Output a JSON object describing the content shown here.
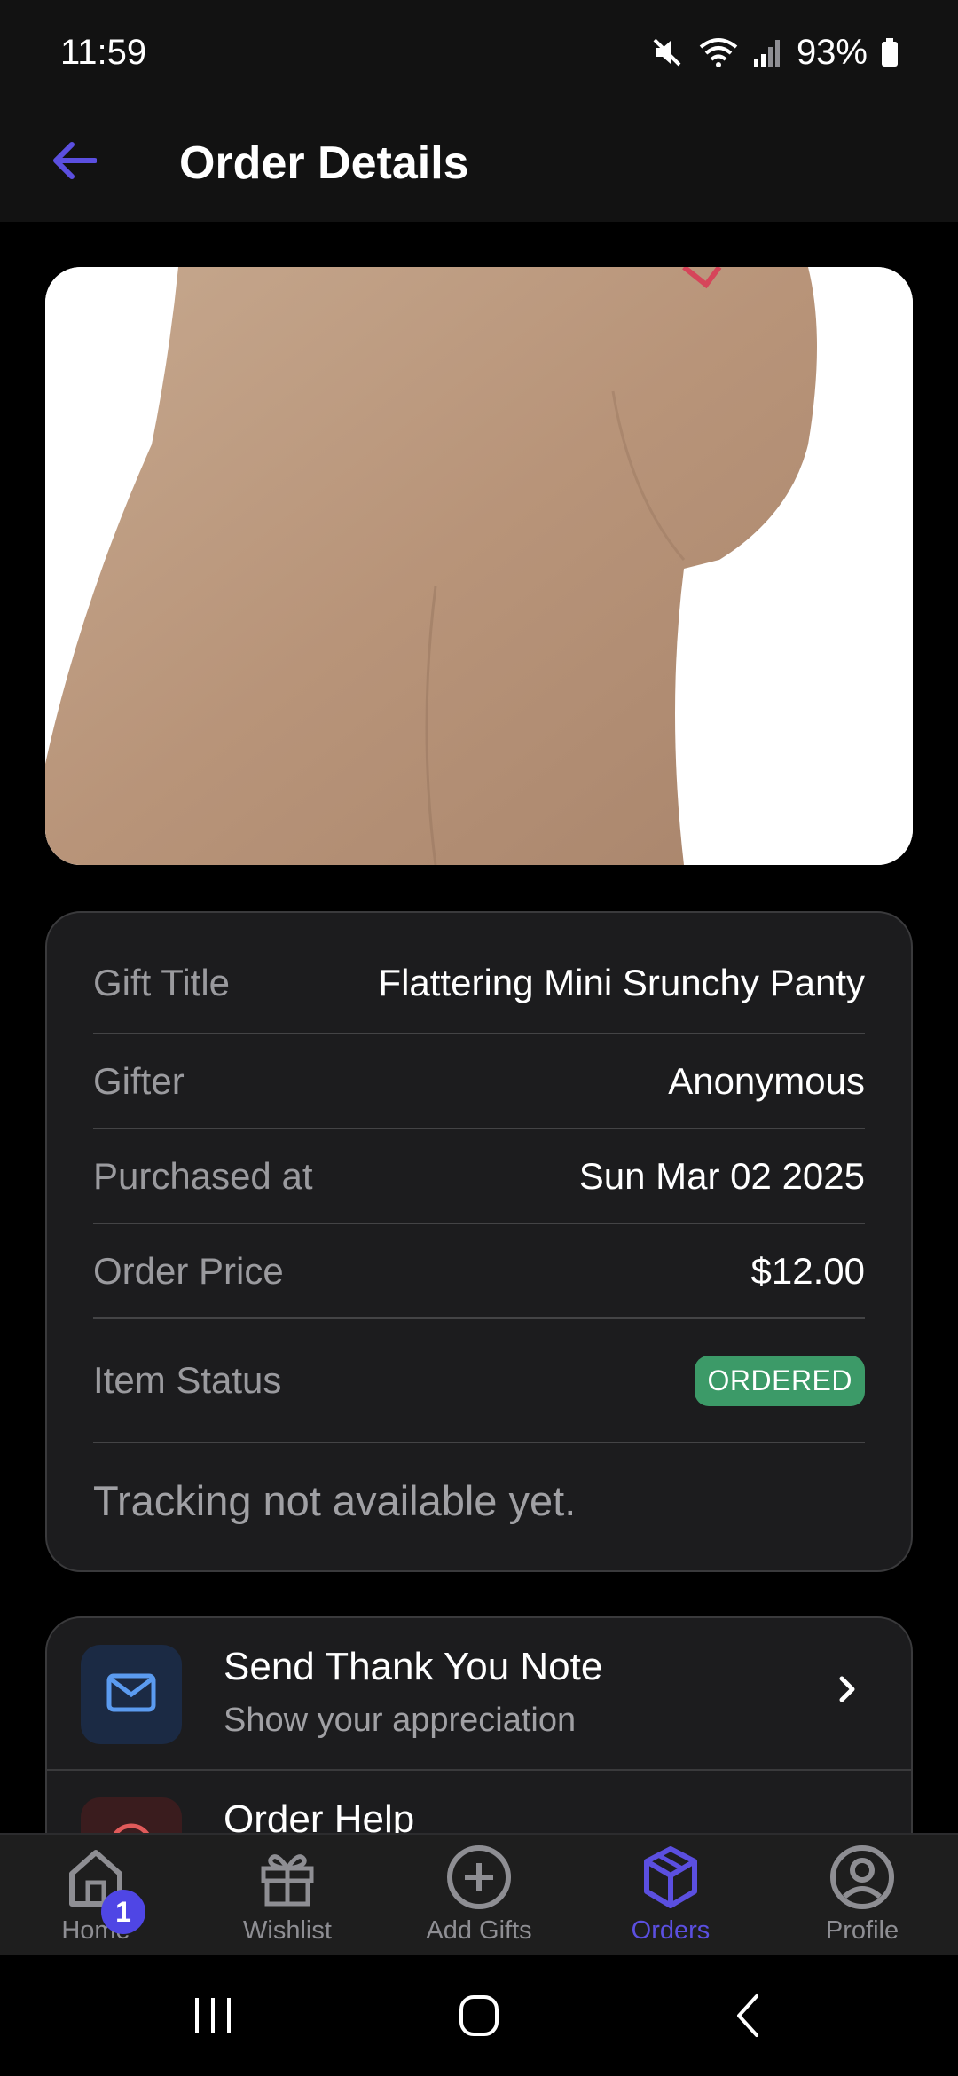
{
  "status_bar": {
    "time": "11:59",
    "battery": "93%",
    "icons": [
      "mute-icon",
      "wifi-icon",
      "signal-icon",
      "battery-icon"
    ]
  },
  "header": {
    "title": "Order Details",
    "back_icon": "arrow-left-icon"
  },
  "product": {
    "image_alt": "product-photo"
  },
  "details": {
    "rows": [
      {
        "label": "Gift Title",
        "value": "Flattering Mini Srunchy Panty"
      },
      {
        "label": "Gifter",
        "value": "Anonymous"
      },
      {
        "label": "Purchased at",
        "value": "Sun Mar 02 2025"
      },
      {
        "label": "Order Price",
        "value": "$12.00"
      }
    ],
    "status_label": "Item Status",
    "status_value": "ORDERED",
    "tracking_text": "Tracking not available yet."
  },
  "actions": [
    {
      "title": "Send Thank You Note",
      "subtitle": "Show your appreciation",
      "icon": "mail-icon"
    },
    {
      "title": "Order Help",
      "subtitle": "",
      "icon": "help-icon"
    }
  ],
  "bottom_nav": {
    "items": [
      {
        "label": "Home",
        "icon": "home-icon",
        "badge": "1"
      },
      {
        "label": "Wishlist",
        "icon": "gift-icon"
      },
      {
        "label": "Add Gifts",
        "icon": "plus-circle-icon"
      },
      {
        "label": "Orders",
        "icon": "box-icon",
        "active": true
      },
      {
        "label": "Profile",
        "icon": "profile-icon"
      }
    ]
  },
  "colors": {
    "accent": "#5b4fe0",
    "status_green": "#3c9a68",
    "card_bg": "#1c1c1e",
    "mail_box_bg": "#1b2a44",
    "help_box_bg": "#3a1c1e"
  }
}
